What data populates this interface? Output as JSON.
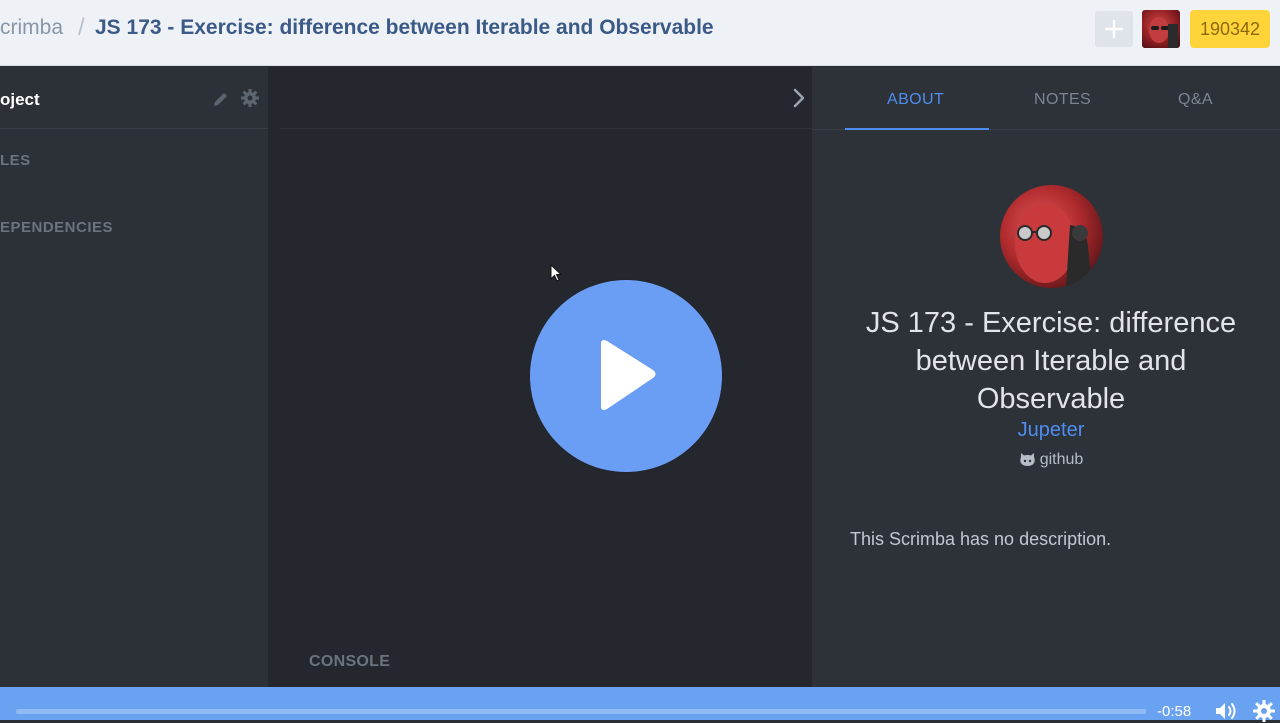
{
  "header": {
    "brand": "crimba",
    "separator": "/",
    "title": "JS 173 - Exercise: difference between Iterable and Observable",
    "points": "190342"
  },
  "sidebar": {
    "project_label": "oject",
    "files_label": "LES",
    "dependencies_label": "EPENDENCIES"
  },
  "editor": {
    "console_label": "CONSOLE"
  },
  "info_panel": {
    "tabs": [
      {
        "label": "ABOUT",
        "active": true
      },
      {
        "label": "NOTES",
        "active": false
      },
      {
        "label": "Q&A",
        "active": false
      }
    ],
    "scrim_title": "JS 173 - Exercise: difference between Iterable and Observable",
    "author": "Jupeter",
    "github_label": "github",
    "description": "This Scrimba has no description."
  },
  "player": {
    "time_remaining": "-0:58",
    "progress_fraction": 0.0
  },
  "colors": {
    "accent": "#4f8df0",
    "play_button": "#6a9ef5",
    "player_bar": "#6aa2f2",
    "points_badge": "#ffd43b"
  },
  "icons": [
    "plus-icon",
    "pencil-icon",
    "gear-icon",
    "chevron-right-icon",
    "play-icon",
    "github-icon",
    "volume-icon",
    "settings-icon"
  ]
}
